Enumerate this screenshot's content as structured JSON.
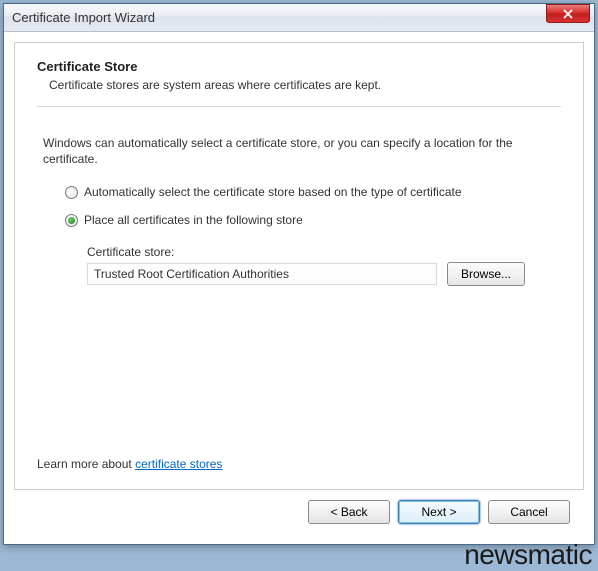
{
  "window": {
    "title": "Certificate Import Wizard"
  },
  "content": {
    "heading": "Certificate Store",
    "subheading": "Certificate stores are system areas where certificates are kept.",
    "description": "Windows can automatically select a certificate store, or you can specify a location for the certificate.",
    "radio_auto": "Automatically select the certificate store based on the type of certificate",
    "radio_place": "Place all certificates in the following store",
    "store_label": "Certificate store:",
    "store_value": "Trusted Root Certification Authorities",
    "browse_label": "Browse...",
    "learn_prefix": "Learn more about ",
    "learn_link": "certificate stores"
  },
  "buttons": {
    "back": "< Back",
    "next": "Next >",
    "cancel": "Cancel"
  },
  "watermark": "newsmatic"
}
